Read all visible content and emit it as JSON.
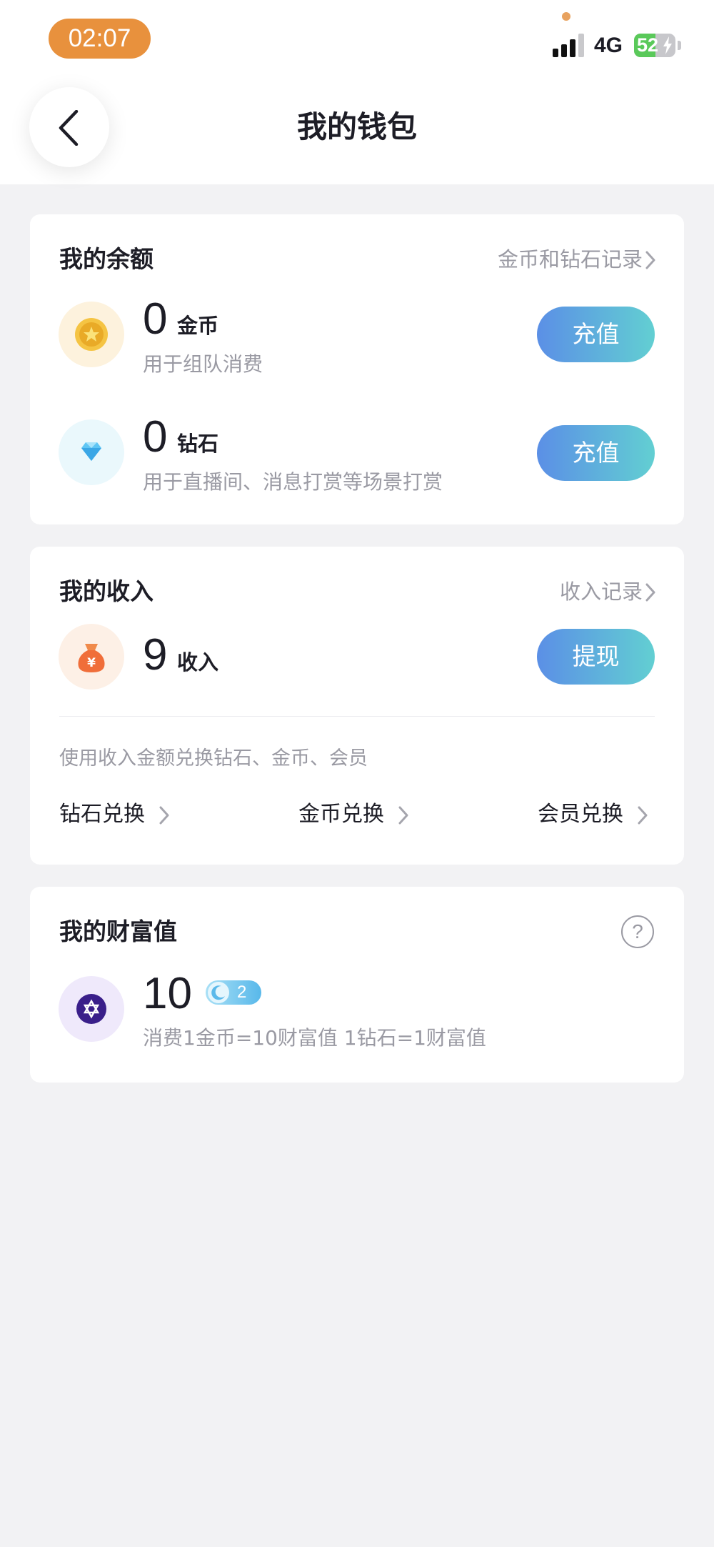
{
  "status_bar": {
    "time": "02:07",
    "network": "4G",
    "battery": "52",
    "battery_level": 0.52
  },
  "header": {
    "title": "我的钱包"
  },
  "balance": {
    "title": "我的余额",
    "record_link": "金币和钻石记录",
    "gold": {
      "amount": "0",
      "unit": "金币",
      "desc": "用于组队消费",
      "button": "充值"
    },
    "diamond": {
      "amount": "0",
      "unit": "钻石",
      "desc": "用于直播间、消息打赏等场景打赏",
      "button": "充值"
    }
  },
  "income": {
    "title": "我的收入",
    "record_link": "收入记录",
    "amount": "9",
    "unit": "收入",
    "button": "提现",
    "hint": "使用收入金额兑换钻石、金币、会员",
    "exchanges": [
      "钻石兑换",
      "金币兑换",
      "会员兑换"
    ]
  },
  "wealth": {
    "title": "我的财富值",
    "help": "?",
    "value": "10",
    "level": "2",
    "desc": "消费1金币=10财富值 1钻石=1财富值"
  },
  "colors": {
    "accent_gradient_start": "#5b8fe6",
    "accent_gradient_end": "#62cfd2",
    "time_pill": "#e8913d",
    "background": "#f2f2f4"
  }
}
